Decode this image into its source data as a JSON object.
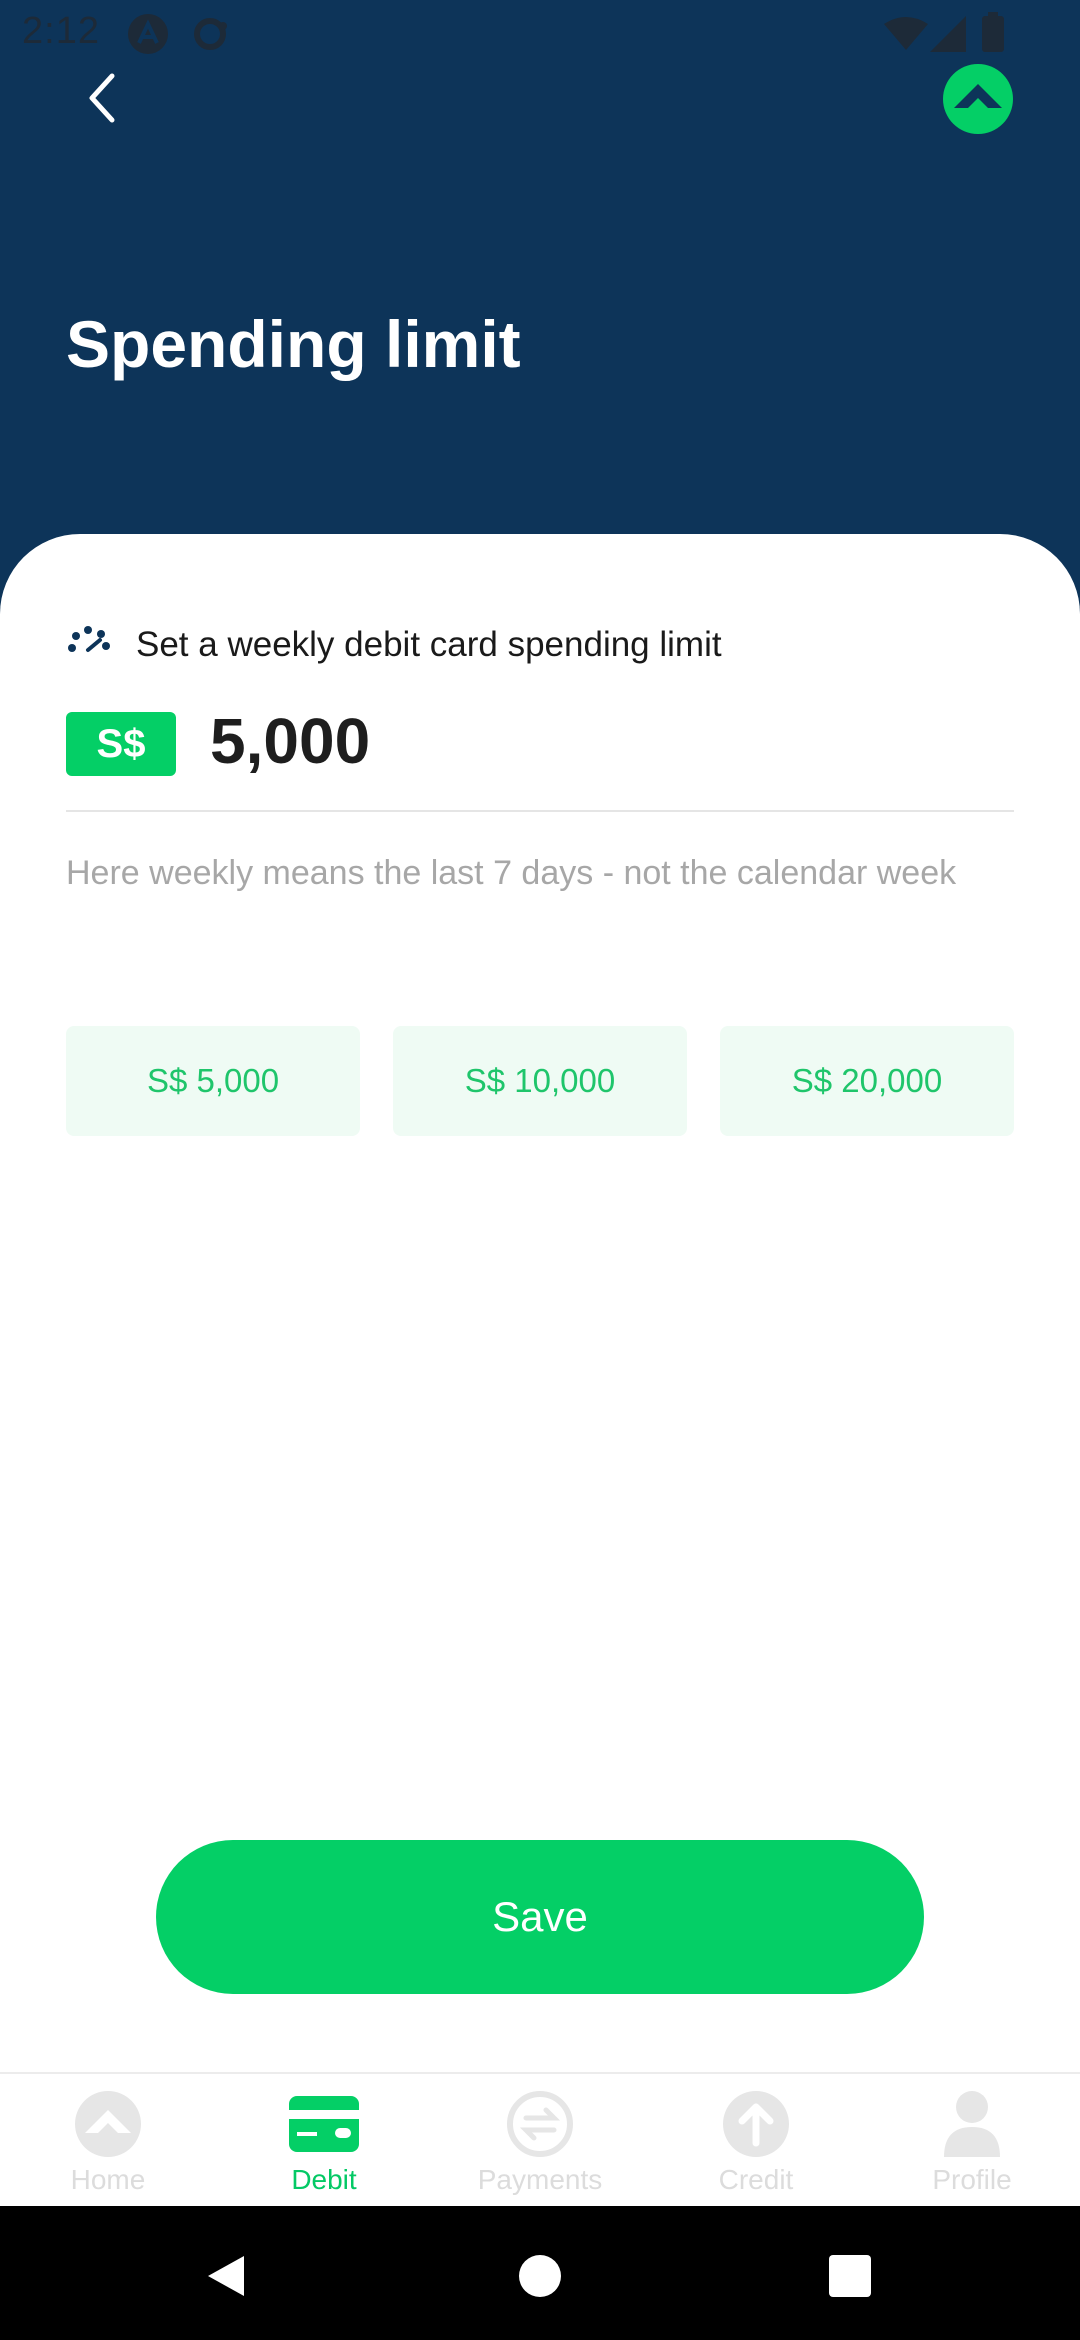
{
  "status_bar": {
    "time": "2:12"
  },
  "header": {
    "title": "Spending limit"
  },
  "limit": {
    "label": "Set a weekly debit card spending limit",
    "currency": "S$",
    "amount": "5,000",
    "helper": "Here weekly means the last 7 days - not the calendar week"
  },
  "presets": [
    "S$ 5,000",
    "S$ 10,000",
    "S$ 20,000"
  ],
  "save_label": "Save",
  "nav": {
    "items": [
      {
        "label": "Home",
        "icon": "home-icon",
        "active": false
      },
      {
        "label": "Debit",
        "icon": "debit-card-icon",
        "active": true
      },
      {
        "label": "Payments",
        "icon": "payments-icon",
        "active": false
      },
      {
        "label": "Credit",
        "icon": "credit-icon",
        "active": false
      },
      {
        "label": "Profile",
        "icon": "profile-icon",
        "active": false
      }
    ]
  },
  "colors": {
    "brand_navy": "#0d3459",
    "accent_green": "#04cf66",
    "chip_bg": "#effbf4"
  }
}
